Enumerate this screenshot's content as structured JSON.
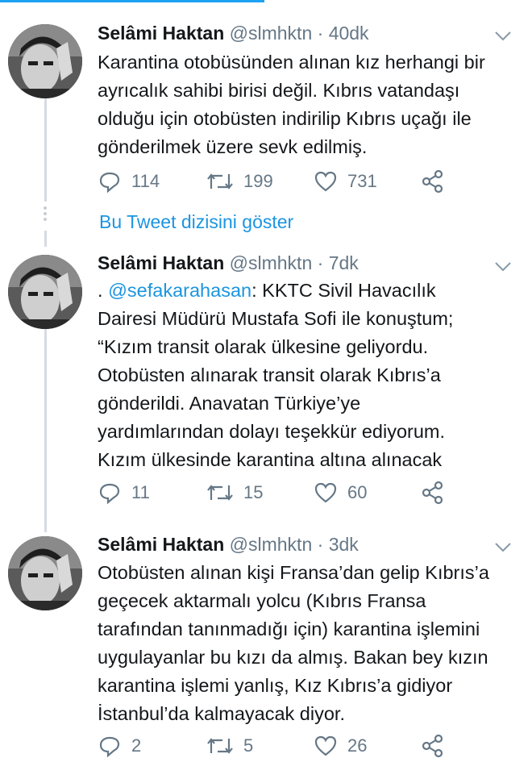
{
  "show_thread_label": "Bu Tweet dizisini göster",
  "colors": {
    "accent": "#1da1f2",
    "link": "#1b95e0",
    "muted": "#657786",
    "text": "#14171a"
  },
  "icons": [
    "reply-icon",
    "retweet-icon",
    "like-icon",
    "share-icon",
    "chevron-down-icon"
  ],
  "tweets": [
    {
      "name": "Selâmi Haktan",
      "handle": "@slmhktn",
      "sep": "·",
      "time": "40dk",
      "lines": [
        "Karantina otobüsünden alınan kız herhangi bir",
        "ayrıcalık sahibi birisi değil. Kıbrıs vatandaşı",
        "olduğu için otobüsten indirilip Kıbrıs uçağı ile",
        "gönderilmek üzere sevk edilmiş."
      ],
      "replies": "114",
      "retweets": "199",
      "likes": "731"
    },
    {
      "name": "Selâmi Haktan",
      "handle": "@slmhktn",
      "sep": "·",
      "time": "7dk",
      "first_line_prefix": ". ",
      "mention": "@sefakarahasan",
      "first_line_rest": ": KKTC Sivil Havacılık",
      "lines": [
        "Dairesi Müdürü Mustafa Sofi ile konuştum;",
        "“Kızım transit olarak ülkesine geliyordu.",
        "Otobüsten alınarak transit olarak Kıbrıs’a",
        "gönderildi. Anavatan Türkiye’ye",
        "yardımlarından dolayı teşekkür ediyorum.",
        "Kızım ülkesinde karantina altına alınacak"
      ],
      "replies": "11",
      "retweets": "15",
      "likes": "60"
    },
    {
      "name": "Selâmi Haktan",
      "handle": "@slmhktn",
      "sep": "·",
      "time": "3dk",
      "lines": [
        "Otobüsten alınan kişi Fransa’dan gelip Kıbrıs’a",
        "geçecek aktarmalı yolcu (Kıbrıs Fransa",
        "tarafından tanınmadığı için) karantina işlemini",
        "uygulayanlar bu kızı da almış. Bakan bey kızın",
        "karantina işlemi yanlış, Kız Kıbrıs’a gidiyor",
        "İstanbul’da kalmayacak diyor."
      ],
      "replies": "2",
      "retweets": "5",
      "likes": "26"
    }
  ]
}
